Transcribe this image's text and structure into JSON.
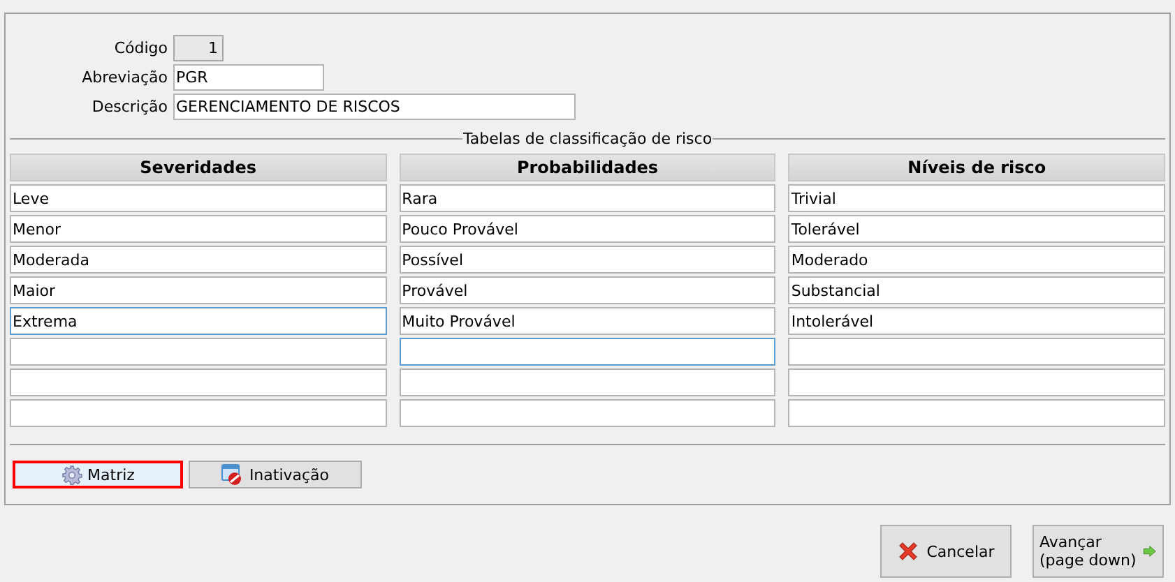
{
  "form": {
    "fields": [
      {
        "label": "Código",
        "value": "1",
        "kind": "readonly"
      },
      {
        "label": "Abreviação",
        "value": "PGR",
        "kind": "short"
      },
      {
        "label": "Descrição",
        "value": "GERENCIAMENTO DE RISCOS",
        "kind": "long"
      }
    ]
  },
  "group_title": "Tabelas de classificação de risco",
  "tables": [
    {
      "header": "Severidades",
      "cells": [
        {
          "text": "Leve",
          "focused": false
        },
        {
          "text": "Menor",
          "focused": false
        },
        {
          "text": "Moderada",
          "focused": false
        },
        {
          "text": "Maior",
          "focused": false
        },
        {
          "text": "Extrema",
          "focused": true
        },
        {
          "focused": false
        },
        {
          "focused": false
        },
        {
          "focused": false
        }
      ]
    },
    {
      "header": "Probabilidades",
      "cells": [
        {
          "text": "Rara",
          "focused": false
        },
        {
          "text": "Pouco Provável",
          "focused": false
        },
        {
          "text": "Possível",
          "focused": false
        },
        {
          "text": "Provável",
          "focused": false
        },
        {
          "text": "Muito Provável",
          "focused": false
        },
        {
          "focused": true
        },
        {
          "focused": false
        },
        {
          "focused": false
        }
      ]
    },
    {
      "header": "Níveis de risco",
      "cells": [
        {
          "text": "Trivial",
          "focused": false
        },
        {
          "text": "Tolerável",
          "focused": false
        },
        {
          "text": "Moderado",
          "focused": false
        },
        {
          "text": "Substancial",
          "focused": false
        },
        {
          "text": "Intolerável",
          "focused": false
        },
        {
          "focused": false
        },
        {
          "focused": false
        },
        {
          "focused": false
        }
      ]
    }
  ],
  "tool_buttons": [
    {
      "label": "Matriz",
      "selected": true
    },
    {
      "label": "Inativação",
      "selected": false
    }
  ],
  "footer_buttons": [
    "Cancelar",
    "Avançar\n(page down)"
  ]
}
